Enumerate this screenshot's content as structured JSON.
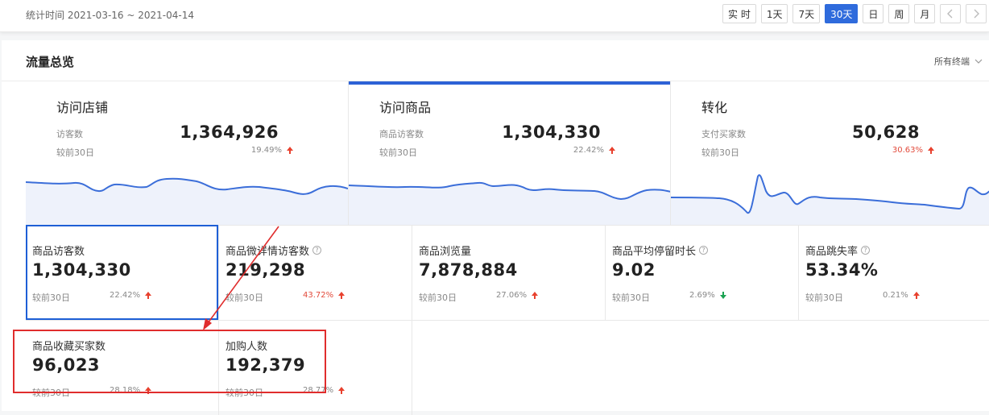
{
  "header": {
    "date_range": "统计时间 2021-03-16 ~ 2021-04-14",
    "periods": [
      "实 时",
      "1天",
      "7天",
      "30天",
      "日",
      "周",
      "月"
    ],
    "active_period": "30天"
  },
  "overview": {
    "title": "流量总览",
    "terminal_select": "所有终端",
    "cards": [
      {
        "title": "访问店铺",
        "label": "访客数",
        "value": "1,364,926",
        "compare": "较前30日",
        "pct": "19.49%",
        "trend": "up"
      },
      {
        "title": "访问商品",
        "label": "商品访客数",
        "value": "1,304,330",
        "compare": "较前30日",
        "pct": "22.42%",
        "trend": "up"
      },
      {
        "title": "转化",
        "label": "支付买家数",
        "value": "50,628",
        "compare": "较前30日",
        "pct": "30.63%",
        "trend": "up"
      }
    ]
  },
  "metrics": [
    {
      "label": "商品访客数",
      "value": "1,304,330",
      "compare": "较前30日",
      "pct": "22.42%",
      "trend": "up",
      "help": false
    },
    {
      "label": "商品微详情访客数",
      "value": "219,298",
      "compare": "较前30日",
      "pct": "43.72%",
      "trend": "up",
      "help": true
    },
    {
      "label": "商品浏览量",
      "value": "7,878,884",
      "compare": "较前30日",
      "pct": "27.06%",
      "trend": "up",
      "help": false
    },
    {
      "label": "商品平均停留时长",
      "value": "9.02",
      "compare": "较前30日",
      "pct": "2.69%",
      "trend": "down",
      "help": true
    },
    {
      "label": "商品跳失率",
      "value": "53.34%",
      "compare": "较前30日",
      "pct": "0.21%",
      "trend": "up",
      "help": true
    },
    {
      "label": "商品收藏买家数",
      "value": "96,023",
      "compare": "较前30日",
      "pct": "28.18%",
      "trend": "up",
      "help": false
    },
    {
      "label": "加购人数",
      "value": "192,379",
      "compare": "较前30日",
      "pct": "28.77%",
      "trend": "up",
      "help": false
    }
  ],
  "colors": {
    "accent": "#2f6bdc",
    "up": "#e8412e",
    "down": "#1aa251",
    "highlight_red": "#e02d2d",
    "highlight_blue": "#1e5fd6"
  }
}
